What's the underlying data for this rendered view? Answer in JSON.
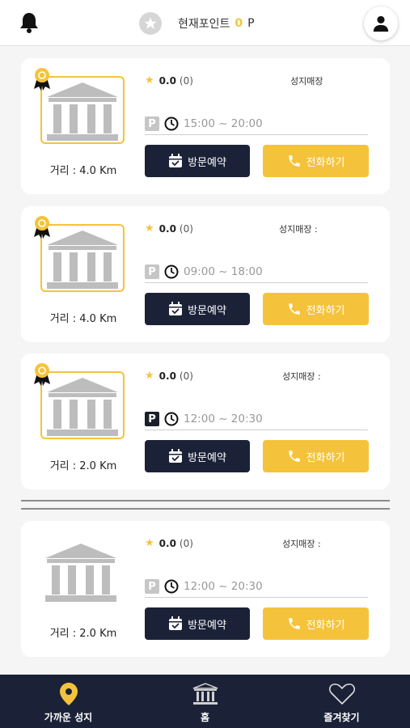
{
  "header": {
    "points_label": "현재포인트",
    "points_value": "0",
    "points_unit": "P"
  },
  "cards": [
    {
      "rating": "0.0",
      "rating_count": "(0)",
      "store_label": "성지매장",
      "parking_style": "light",
      "parking_symbol": "P",
      "hours": "15:00 ~ 20:00",
      "distance": "거리 : 4.0 Km",
      "badge": true
    },
    {
      "rating": "0.0",
      "rating_count": "(0)",
      "store_label": "성지매장 :",
      "parking_style": "light",
      "parking_symbol": "P",
      "hours": "09:00 ~ 18:00",
      "distance": "거리 : 4.0 Km",
      "badge": true
    },
    {
      "rating": "0.0",
      "rating_count": "(0)",
      "store_label": "성지매장 :",
      "parking_style": "dark",
      "parking_symbol": "P",
      "hours": "12:00 ~ 20:30",
      "distance": "거리 : 2.0 Km",
      "badge": true
    },
    {
      "rating": "0.0",
      "rating_count": "(0)",
      "store_label": "성지매장 :",
      "parking_style": "light",
      "parking_symbol": "P",
      "hours": "12:00 ~ 20:30",
      "distance": "거리 : 2.0 Km",
      "badge": false
    }
  ],
  "buttons": {
    "visit_label": "방문예약",
    "call_label": "전화하기"
  },
  "tabs": [
    {
      "label": "가까운 성지",
      "icon": "location-pin-icon"
    },
    {
      "label": "홈",
      "icon": "building-icon"
    },
    {
      "label": "즐겨찾기",
      "icon": "heart-icon"
    }
  ],
  "colors": {
    "accent": "#f5c33b",
    "navy": "#1b2238",
    "muted": "#999999"
  }
}
